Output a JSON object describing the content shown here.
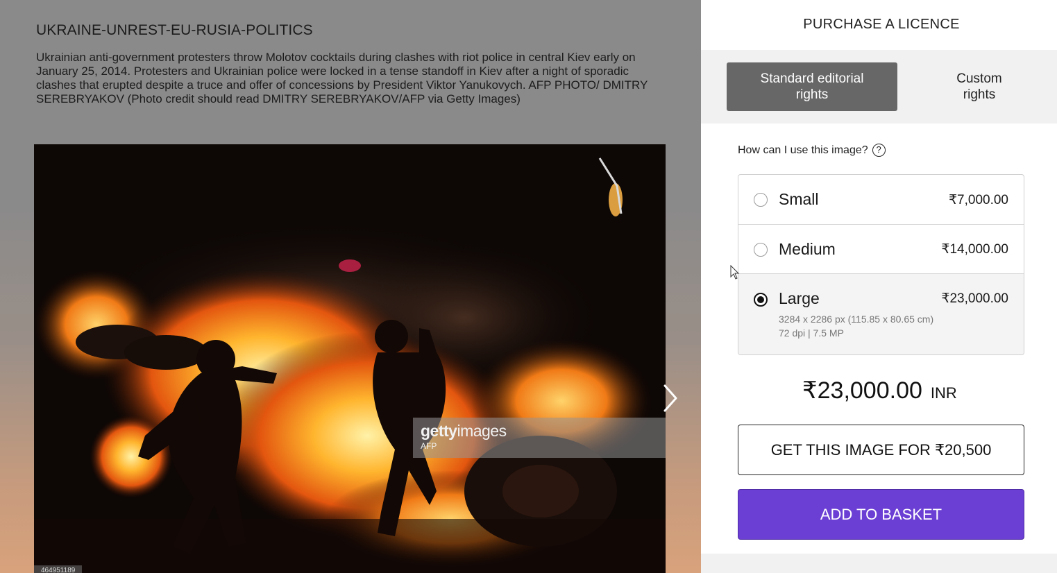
{
  "image": {
    "title": "UKRAINE-UNREST-EU-RUSIA-POLITICS",
    "caption": "Ukrainian anti-government protesters throw Molotov cocktails during clashes with riot police in central Kiev early on January 25, 2014. Protesters and Ukrainian police were locked in a tense standoff in Kiev after a night of sporadic clashes that erupted despite a truce and offer of concessions by President Viktor Yanukovych. AFP PHOTO/ DMITRY SEREBRYAKOV (Photo credit should read DMITRY SEREBRYAKOV/AFP via Getty Images)",
    "watermark_brand_bold": "getty",
    "watermark_brand_light": "images",
    "watermark_source": "AFP",
    "photo_id": "464951189"
  },
  "purchase": {
    "title": "PURCHASE A LICENCE",
    "tabs": [
      {
        "label": "Standard editorial rights",
        "active": true
      },
      {
        "label": "Custom rights",
        "active": false
      }
    ],
    "usage_question": "How can I use this image?",
    "help_symbol": "?",
    "sizes": [
      {
        "name": "Small",
        "price": "₹7,000.00",
        "selected": false
      },
      {
        "name": "Medium",
        "price": "₹14,000.00",
        "selected": false
      },
      {
        "name": "Large",
        "price": "₹23,000.00",
        "selected": true,
        "dimensions": "3284 x 2286 px (115.85 x 80.65 cm)",
        "resolution": "72 dpi | 7.5 MP"
      }
    ],
    "total_amount": "₹23,000.00",
    "total_currency": "INR",
    "get_image_label": "GET THIS IMAGE FOR ₹20,500",
    "add_to_basket_label": "ADD TO BASKET"
  },
  "colors": {
    "accent_purple": "#6b3fd4",
    "tab_active_bg": "#676767"
  },
  "icons": [
    "chevron-right-icon",
    "help-icon",
    "mouse-cursor-icon",
    "radio-selected-icon"
  ]
}
